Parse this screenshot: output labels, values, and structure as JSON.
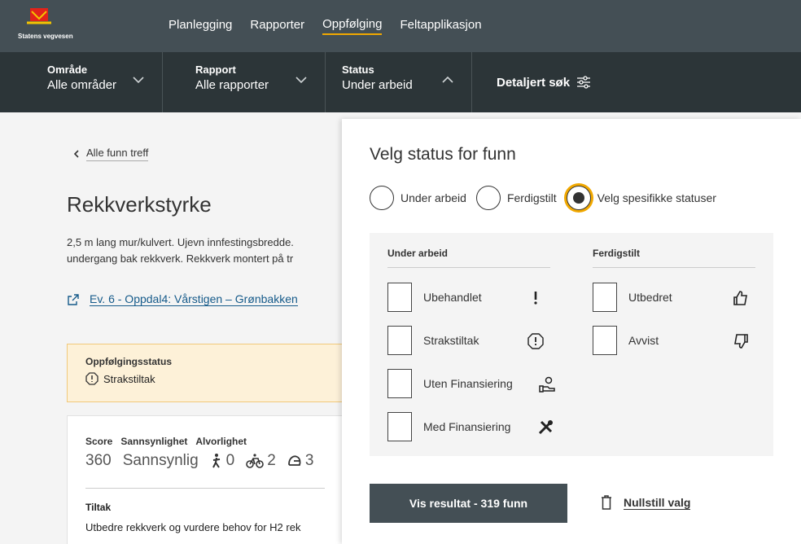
{
  "brand": {
    "logo_text": "Statens vegvesen"
  },
  "nav": [
    {
      "label": "Planlegging",
      "active": false
    },
    {
      "label": "Rapporter",
      "active": false
    },
    {
      "label": "Oppfølging",
      "active": true
    },
    {
      "label": "Feltapplikasjon",
      "active": false
    }
  ],
  "filters": {
    "omrade": {
      "label": "Område",
      "value": "Alle områder",
      "icon": "chevron-down-icon"
    },
    "rapport": {
      "label": "Rapport",
      "value": "Alle rapporter",
      "icon": "chevron-down-icon"
    },
    "status": {
      "label": "Status",
      "value": "Under arbeid",
      "icon": "chevron-up-icon"
    },
    "search": {
      "label": "Detaljert søk",
      "icon": "sliders-icon"
    }
  },
  "main": {
    "back": "Alle funn treff",
    "title": "Rekkverkstyrke",
    "description_line1": "2,5 m lang mur/kulvert. Ujevn innfestingsbredde.",
    "description_line2": "undergang bak rekkverk. Rekkverk montert på tr",
    "road_link": "Ev. 6 - Oppdal4: Vårstigen – Grønbakken",
    "followup": {
      "label": "Oppfølgingsstatus",
      "value": "Strakstiltak"
    },
    "card": {
      "headers": [
        "Score",
        "Sannsynlighet",
        "Alvorlighet"
      ],
      "score": "360",
      "probability": "Sannsynlig",
      "pedestrian": "0",
      "bicycle": "2",
      "mc": "3",
      "tiltak_label": "Tiltak",
      "tiltak_text": "Utbedre rekkverk og vurdere behov for H2 rek"
    }
  },
  "panel": {
    "title": "Velg status for funn",
    "radios": [
      {
        "label": "Under arbeid",
        "selected": false
      },
      {
        "label": "Ferdigstilt",
        "selected": false
      },
      {
        "label": "Velg spesifikke statuser",
        "selected": true
      }
    ],
    "col1": {
      "header": "Under arbeid",
      "items": [
        {
          "label": "Ubehandlet",
          "icon": "exclamation-icon"
        },
        {
          "label": "Strakstiltak",
          "icon": "alert-octagon-icon"
        },
        {
          "label": "Uten Finansiering",
          "icon": "hand-money-icon"
        },
        {
          "label": "Med Finansiering",
          "icon": "tools-icon"
        }
      ]
    },
    "col2": {
      "header": "Ferdigstilt",
      "items": [
        {
          "label": "Utbedret",
          "icon": "thumbs-up-icon"
        },
        {
          "label": "Avvist",
          "icon": "thumbs-down-icon"
        }
      ]
    },
    "submit": "Vis resultat - 319 funn",
    "reset": "Nullstill valg"
  },
  "colors": {
    "accent": "#f1a800",
    "nav_bg": "#444f55",
    "filter_bg": "#2c3538"
  }
}
